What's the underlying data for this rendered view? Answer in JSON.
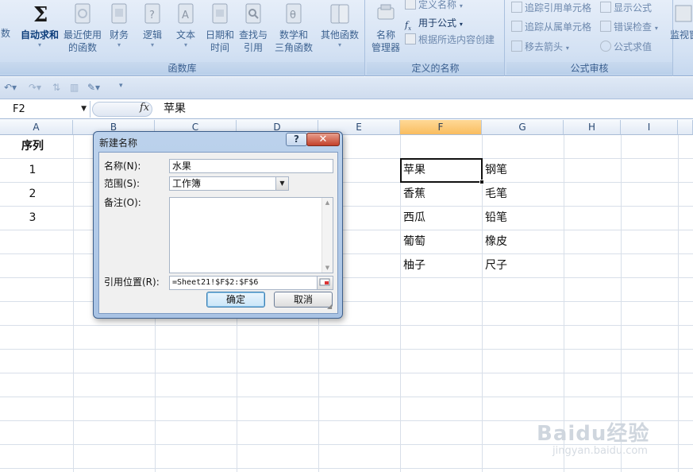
{
  "ribbon": {
    "function_library": {
      "label": "函数库",
      "buttons": [
        {
          "label1": "数",
          "label2": ""
        },
        {
          "label1": "自动求和",
          "label2": ""
        },
        {
          "label1": "最近使用",
          "label2": "的函数"
        },
        {
          "label1": "财务",
          "label2": ""
        },
        {
          "label1": "逻辑",
          "label2": ""
        },
        {
          "label1": "文本",
          "label2": ""
        },
        {
          "label1": "日期和",
          "label2": "时间"
        },
        {
          "label1": "查找与",
          "label2": "引用"
        },
        {
          "label1": "数学和",
          "label2": "三角函数"
        },
        {
          "label1": "其他函数",
          "label2": ""
        }
      ]
    },
    "defined_names": {
      "label": "定义的名称",
      "manager_label1": "名称",
      "manager_label2": "管理器",
      "define_name": "定义名称",
      "use_in_formula": "用于公式",
      "create_from_selection": "根据所选内容创建"
    },
    "formula_auditing": {
      "label": "公式审核",
      "trace_precedents": "追踪引用单元格",
      "trace_dependents": "追踪从属单元格",
      "remove_arrows": "移去箭头",
      "show_formulas": "显示公式",
      "error_checking": "错误检查",
      "evaluate_formula": "公式求值",
      "watch_window": "监视窗"
    }
  },
  "formula_bar": {
    "name_box": "F2",
    "fx": "fx",
    "content": "苹果"
  },
  "columns": [
    "A",
    "B",
    "C",
    "D",
    "E",
    "F",
    "G",
    "H",
    "I"
  ],
  "cells": {
    "a1": "序列",
    "a2": "1",
    "a3": "2",
    "a4": "3",
    "f2": "苹果",
    "f3": "香蕉",
    "f4": "西瓜",
    "f5": "葡萄",
    "f6": "柚子",
    "g2": "钢笔",
    "g3": "毛笔",
    "g4": "铅笔",
    "g5": "橡皮",
    "g6": "尺子"
  },
  "dialog": {
    "title": "新建名称",
    "help": "?",
    "close": "✕",
    "name_label": "名称(N):",
    "name_value": "水果",
    "scope_label": "范围(S):",
    "scope_value": "工作簿",
    "comment_label": "备注(O):",
    "ref_label": "引用位置(R):",
    "ref_value": "=Sheet21!$F$2:$F$6",
    "ok": "确定",
    "cancel": "取消"
  },
  "watermark": {
    "brand": "Baidu经验",
    "url": "jingyan.baidu.com"
  }
}
